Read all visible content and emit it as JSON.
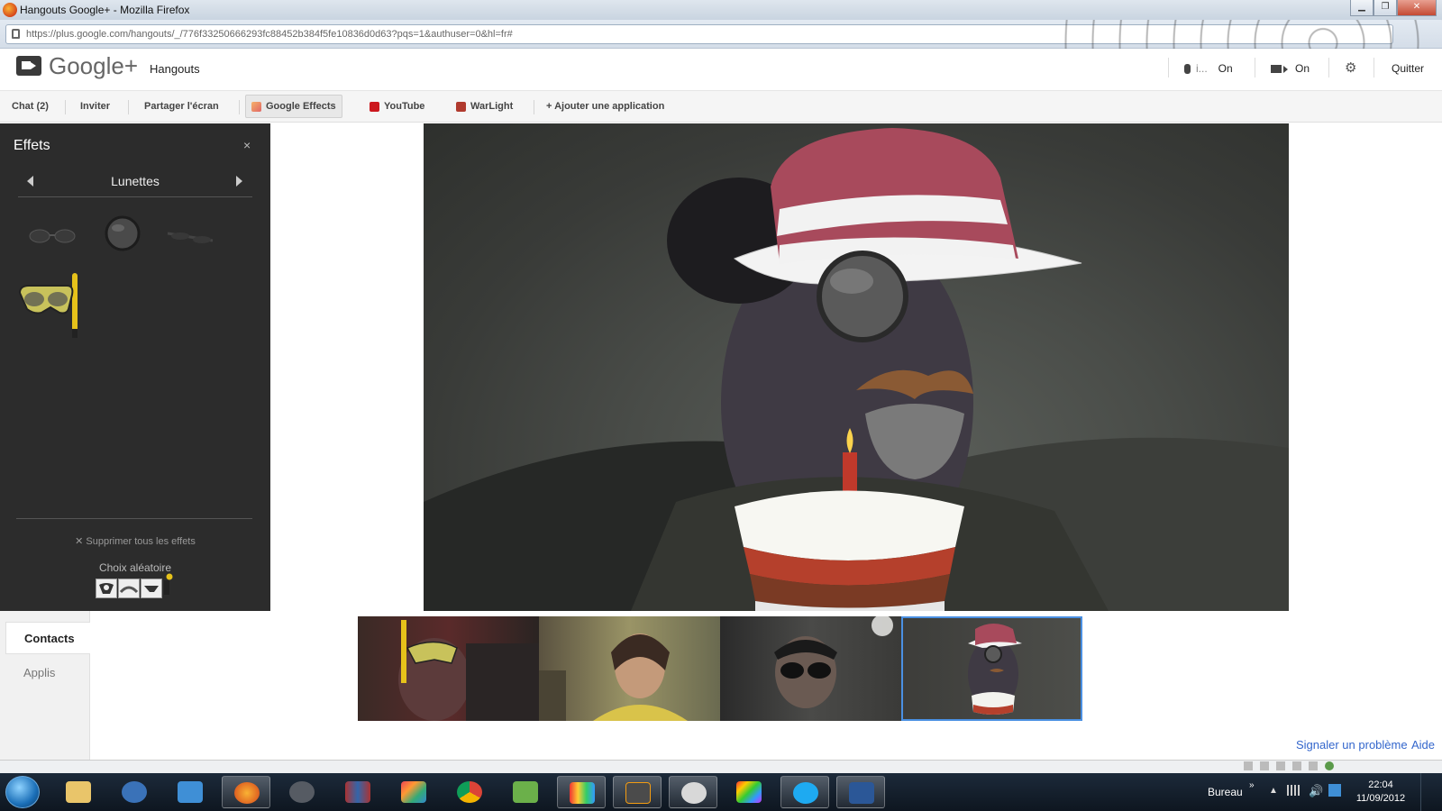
{
  "browser": {
    "window_title": "Hangouts Google+ - Mozilla Firefox",
    "url": "https://plus.google.com/hangouts/_/776f33250666293fc88452b384f5fe10836d0d63?pqs=1&authuser=0&hl=fr#"
  },
  "header": {
    "brand": "Google+",
    "section": "Hangouts",
    "mic_state": "On",
    "mic_level": "i...",
    "camera_state": "On",
    "quit_label": "Quitter"
  },
  "toolbar": {
    "chat": "Chat (2)",
    "invite": "Inviter",
    "share_screen": "Partager l'écran",
    "google_effects": "Google Effects",
    "youtube": "YouTube",
    "warlight": "WarLight",
    "add_app": "+ Ajouter une application"
  },
  "effects": {
    "title": "Effets",
    "close": "×",
    "category": "Lunettes",
    "remove_all": "✕ Supprimer tous les effets",
    "random_choice": "Choix aléatoire",
    "items": [
      "sunglasses",
      "monocle",
      "glasses",
      "snorkel-mask"
    ]
  },
  "contacts_tabs": {
    "contacts": "Contacts",
    "apps": "Applis"
  },
  "footer_links": {
    "report": "Signaler un problème",
    "help": "Aide"
  },
  "taskbar": {
    "location": "Bureau",
    "time": "22:04",
    "date": "11/09/2012",
    "apps": [
      "explorer",
      "thunderbird",
      "dropbox",
      "firefox",
      "steam",
      "library",
      "office",
      "chrome",
      "evernote",
      "studio",
      "sublime-text",
      "avatar",
      "color-app",
      "skype",
      "powershell"
    ]
  },
  "colors": {
    "effects_panel": "#2c2c2c",
    "link": "#3366cc",
    "selected_thumb": "#4a90e2"
  }
}
